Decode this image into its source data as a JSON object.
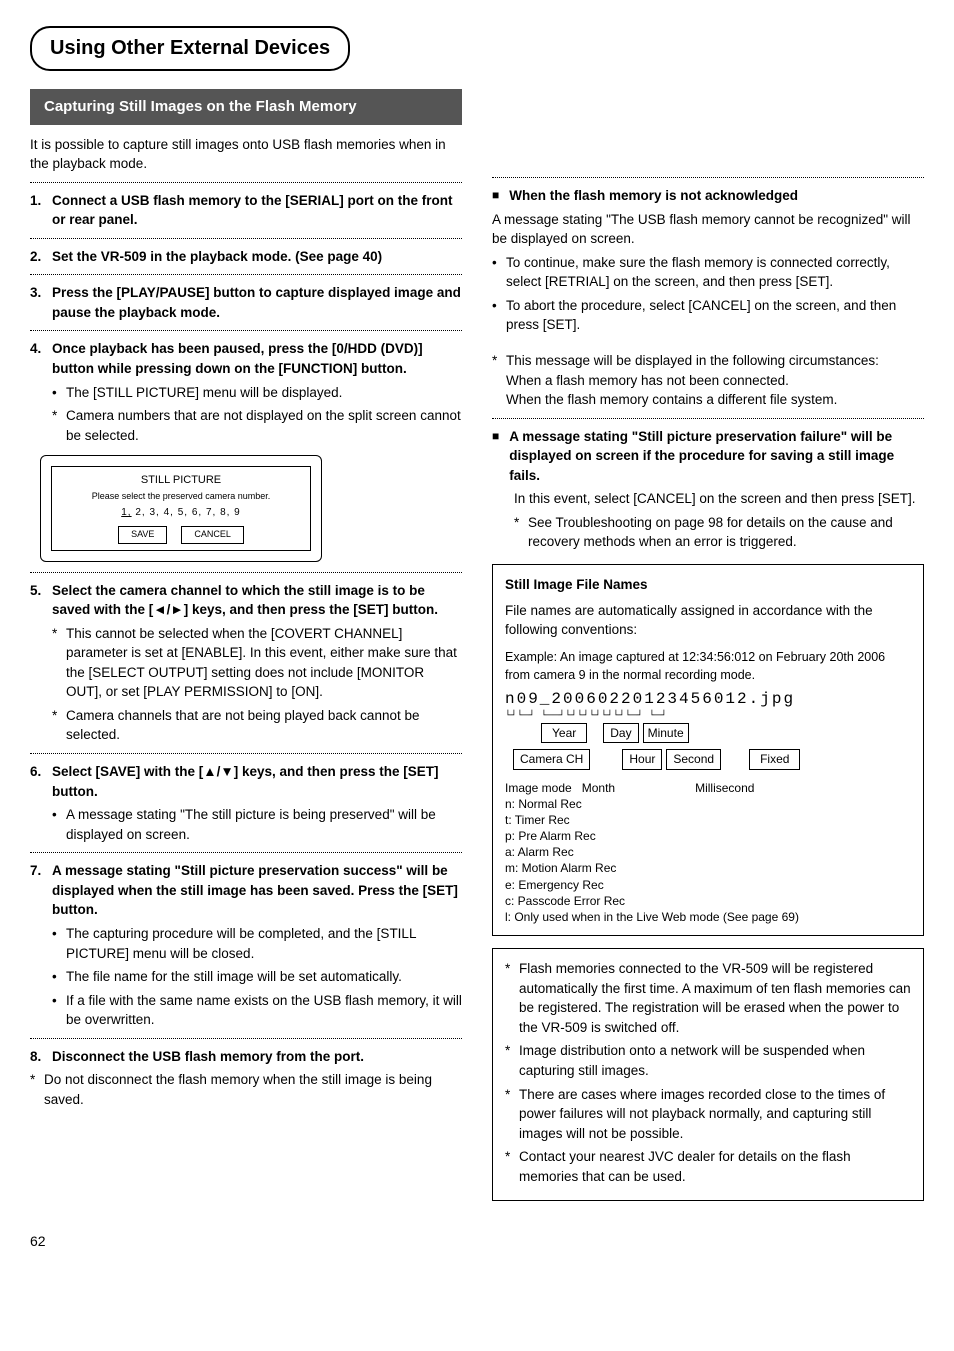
{
  "page_title": "Using Other External Devices",
  "section_title": "Capturing Still Images on the Flash Memory",
  "intro": "It is possible to capture still images onto USB flash memories when in the playback mode.",
  "steps": [
    {
      "n": "1.",
      "t": "Connect a USB flash memory to the [SERIAL] port on the front or rear panel."
    },
    {
      "n": "2.",
      "t": "Set the VR-509 in the playback mode. (See page 40)"
    },
    {
      "n": "3.",
      "t": "Press the [PLAY/PAUSE] button to capture displayed image and pause the playback mode."
    },
    {
      "n": "4.",
      "t": "Once playback has been paused, press the [0/HDD (DVD)] button while pressing down on the [FUNCTION] button."
    }
  ],
  "step4_bullets": [
    "The [STILL PICTURE] menu will be displayed."
  ],
  "step4_stars": [
    "Camera numbers that are not displayed on the split screen cannot be selected."
  ],
  "dialog": {
    "title": "STILL PICTURE",
    "msg": "Please select the preserved camera number.",
    "nums_first": "1,",
    "nums_rest": " 2, 3, 4, 5, 6, 7, 8, 9",
    "save": "SAVE",
    "cancel": "CANCEL"
  },
  "step5": {
    "n": "5.",
    "t": "Select the camera channel to which the still image is to be saved with the [◄/►] keys, and then press the [SET] button."
  },
  "step5_stars": [
    "This cannot be selected when the [COVERT CHANNEL] parameter is set at [ENABLE]. In this event, either make sure that the [SELECT OUTPUT] setting does not include [MONITOR OUT], or set [PLAY PERMISSION] to [ON].",
    "Camera channels that are not being played back cannot be selected."
  ],
  "step6": {
    "n": "6.",
    "t": "Select [SAVE] with the [▲/▼] keys, and then press the [SET] button."
  },
  "step6_bullets": [
    "A message stating \"The still picture is being preserved\" will be displayed on screen."
  ],
  "step7": {
    "n": "7.",
    "t": "A message stating \"Still picture preservation success\" will be displayed when the still image has been saved. Press the [SET] button."
  },
  "step7_bullets": [
    "The capturing procedure will be completed, and the [STILL PICTURE] menu will be closed.",
    "The file name for the still image will be set automatically.",
    "If a file with the same name exists on the USB flash memory, it will be overwritten."
  ],
  "step8": {
    "n": "8.",
    "t": "Disconnect the USB flash memory from the port."
  },
  "step8_star": "Do not disconnect the flash memory when the still image is being saved.",
  "right": {
    "h1": "When the flash memory is not acknowledged",
    "p1": "A message stating \"The USB flash memory cannot be recognized\" will be displayed on screen.",
    "b": [
      "To continue, make sure the flash memory is connected correctly, select [RETRIAL] on the screen, and then press [SET].",
      "To abort the procedure, select [CANCEL] on the screen, and then press [SET]."
    ],
    "s_intro": "This message will be displayed in the following circumstances:",
    "s_lines": [
      "When a flash memory has not been connected.",
      "When the flash memory contains a different file system."
    ],
    "h2": "A message stating \"Still picture preservation failure\" will be displayed on screen if the procedure for saving a still image fails.",
    "h2_p": "In this event, select [CANCEL] on the screen and then press [SET].",
    "h2_star": "See Troubleshooting on page 98 for details on the cause and recovery methods when an error is triggered."
  },
  "filebox": {
    "title": "Still Image File Names",
    "lead": "File names are automatically assigned in accordance with the following conventions:",
    "example": "Example: An image captured at 12:34:56:012 on February 20th 2006 from camera 9 in the normal recording mode.",
    "fname": "n09_20060220123456012.jpg",
    "row_year": "Year",
    "row_day": "Day",
    "row_min": "Minute",
    "row_cam": "Camera CH",
    "row_hour": "Hour",
    "row_sec": "Second",
    "row_fixed": "Fixed",
    "row_mode": "Image mode",
    "row_month": "Month",
    "row_ms": "Millisecond",
    "modes": [
      "n: Normal Rec",
      "t: Timer Rec",
      "p: Pre Alarm Rec",
      "a: Alarm Rec",
      "m: Motion Alarm Rec",
      "e: Emergency Rec",
      "c: Passcode Error Rec",
      "l: Only used when in the Live Web mode (See page 69)"
    ]
  },
  "notes": [
    "Flash memories connected to the VR-509 will be registered automatically the first time. A maximum of ten flash memories can be registered. The registration will be erased when the power to the VR-509 is switched off.",
    "Image distribution onto a network will be suspended when capturing still images.",
    "There are cases where images recorded close to the times of power failures will not playback normally, and capturing still images will not be possible.",
    "Contact your nearest JVC dealer for details on the flash memories that can be used."
  ],
  "page_number": "62"
}
